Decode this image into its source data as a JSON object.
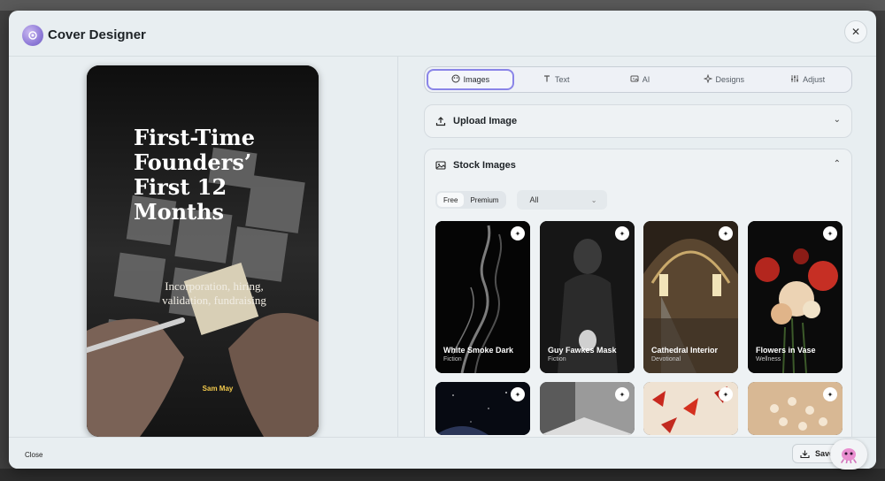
{
  "window": {
    "title": "Cover Designer",
    "close_glyph": "✕"
  },
  "cover": {
    "title": "First-Time\nFounders’\nFirst 12\nMonths",
    "subtitle": "Incorporation, hiring,\nvalidation, fundraising",
    "author": "Sam May"
  },
  "tabs": [
    {
      "label": "Images",
      "icon": "image-icon",
      "active": true
    },
    {
      "label": "Text",
      "icon": "text-icon",
      "active": false
    },
    {
      "label": "AI",
      "icon": "ai-icon",
      "active": false
    },
    {
      "label": "Designs",
      "icon": "sparkle-icon",
      "active": false
    },
    {
      "label": "Adjust",
      "icon": "sliders-icon",
      "active": false
    }
  ],
  "upload": {
    "label": "Upload Image"
  },
  "stock": {
    "label": "Stock Images",
    "filters": {
      "free": "Free",
      "premium": "Premium",
      "category": "All"
    },
    "images": [
      {
        "name": "White Smoke Dark",
        "category": "Fiction"
      },
      {
        "name": "Guy Fawkes Mask",
        "category": "Fiction"
      },
      {
        "name": "Cathedral Interior",
        "category": "Devotional"
      },
      {
        "name": "Flowers in Vase",
        "category": "Wellness"
      }
    ]
  },
  "footer": {
    "close_label": "Close",
    "save_label": "Save"
  },
  "colors": {
    "accent": "#8a85e8",
    "author_text": "#f2c94c",
    "modal_bg": "#e8eef1"
  }
}
